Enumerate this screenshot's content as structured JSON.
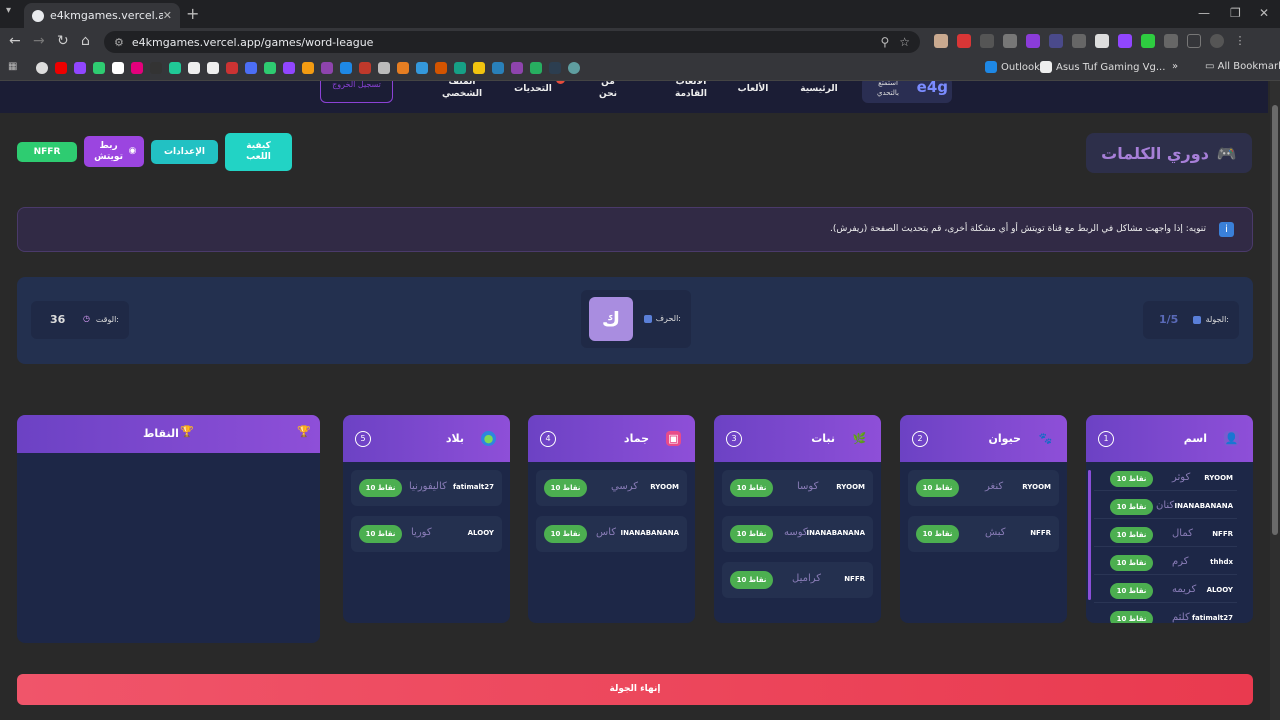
{
  "browser": {
    "tab_title": "e4kmgames.vercel.app/games/",
    "url": "e4kmgames.vercel.app/games/word-league",
    "bookmarks": {
      "outlook": "Outlook",
      "asus": "Asus Tuf Gaming Vg...",
      "all": "All Bookmarks"
    }
  },
  "nav": {
    "logout": "تسجيل الخروج",
    "profile": "الملف الشخصي",
    "challenges": "التحديات",
    "about": "من نحن",
    "upcoming": "الألعاب القادمة",
    "games": "الألعاب",
    "home": "الرئيسية",
    "challenge_tag": "استمتع بالتحدي",
    "logo": "e4g"
  },
  "header": {
    "title": "دوري الكلمات",
    "how_to_play": "كيفية اللعب",
    "settings": "الإعدادات",
    "twitch_link": "ربط تويتش",
    "user_button": "NFFR"
  },
  "notice": "تنويه: إذا واجهت مشاكل في الربط مع قناة تويتش أو أي مشكلة أخرى، قم بتحديث الصفحة (ريفرش).",
  "round": {
    "label": "الجولة:",
    "value": "1/5"
  },
  "letter": {
    "label": "الحرف:",
    "value": "ك"
  },
  "time": {
    "label": "الوقت:",
    "value": "36"
  },
  "categories": [
    {
      "name": "اسم",
      "number": "1",
      "entries": [
        {
          "player": "RYOOM",
          "word": "كوثر",
          "points": "10 نقاط"
        },
        {
          "player": "INANABANANA",
          "word": "كنان",
          "points": "10 نقاط"
        },
        {
          "player": "NFFR",
          "word": "كمال",
          "points": "10 نقاط"
        },
        {
          "player": "thhdx",
          "word": "كرم",
          "points": "10 نقاط"
        },
        {
          "player": "ALOOY",
          "word": "كريمه",
          "points": "10 نقاط"
        },
        {
          "player": "fatimalt27",
          "word": "كلثم",
          "points": "10 نقاط"
        }
      ]
    },
    {
      "name": "حيوان",
      "number": "2",
      "entries": [
        {
          "player": "RYOOM",
          "word": "كنغر",
          "points": "10 نقاط"
        },
        {
          "player": "NFFR",
          "word": "كبش",
          "points": "10 نقاط"
        }
      ]
    },
    {
      "name": "نبات",
      "number": "3",
      "entries": [
        {
          "player": "RYOOM",
          "word": "كوسا",
          "points": "10 نقاط"
        },
        {
          "player": "INANABANANA",
          "word": "كوسه",
          "points": "10 نقاط"
        },
        {
          "player": "NFFR",
          "word": "كراميل",
          "points": "10 نقاط"
        }
      ]
    },
    {
      "name": "جماد",
      "number": "4",
      "entries": [
        {
          "player": "RYOOM",
          "word": "كرسي",
          "points": "10 نقاط"
        },
        {
          "player": "INANABANANA",
          "word": "كاس",
          "points": "10 نقاط"
        }
      ]
    },
    {
      "name": "بلاد",
      "number": "5",
      "entries": [
        {
          "player": "fatimalt27",
          "word": "كاليفورنيا",
          "points": "10 نقاط"
        },
        {
          "player": "ALOOY",
          "word": "كوريا",
          "points": "10 نقاط"
        }
      ]
    }
  ],
  "scores": {
    "title": "النقاط"
  },
  "end_round": "إنهاء الجولة",
  "colors": {
    "accent": "#8e4fd8",
    "points": "#4caf50",
    "end": "#e93a4f",
    "teal": "#22c1c3",
    "user": "#2ecc71"
  }
}
